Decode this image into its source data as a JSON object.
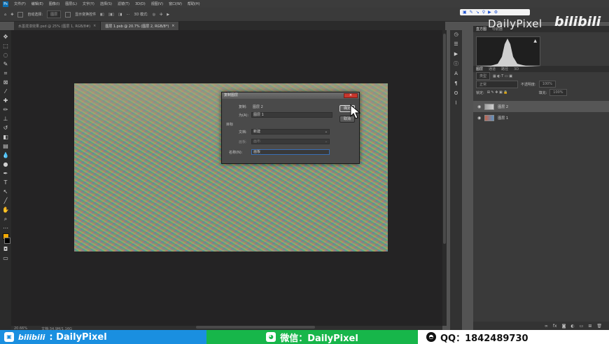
{
  "menubar": {
    "app_icon": "Ps",
    "items": [
      "文件(F)",
      "编辑(E)",
      "图像(I)",
      "图层(L)",
      "文字(Y)",
      "选择(S)",
      "滤镜(T)",
      "3D(D)",
      "视图(V)",
      "窗口(W)",
      "帮助(H)"
    ]
  },
  "options_bar": {
    "auto_select_label": "自动选择:",
    "auto_select_value": "图层",
    "show_transform_label": "显示变换控件",
    "mode_3d_label": "3D 模式:"
  },
  "tabs": [
    {
      "label": "水墨泼漆效果.psd @ 25% (图层 1, RGB/8#)",
      "close": "×"
    },
    {
      "label": "图层 1.psb @ 20.7% (图层 2, RGB/8*)",
      "close": "×"
    }
  ],
  "status": {
    "zoom": "20.66%",
    "doc": "文档:34.9M/1.16G"
  },
  "dialog": {
    "title": "复制图层",
    "close": "×",
    "copy_label": "复制:",
    "copy_value": "图层 2",
    "as_label": "为(A):",
    "as_value": "图层 1",
    "target_label": "目标",
    "doc_label": "文档:",
    "doc_value": "新建",
    "artboard_label": "画板:",
    "artboard_value": "画布",
    "name_label": "名称(N):",
    "name_value": "画板",
    "ok_label": "确定",
    "cancel_label": "取消"
  },
  "right_panel": {
    "histo_tabs": [
      "直方图",
      "导航器"
    ],
    "layer_tabs": [
      "图层",
      "通道",
      "路径",
      "3D"
    ],
    "kind_label": "类型",
    "blend_mode": "正常",
    "opacity_label": "不透明度:",
    "opacity_value": "100%",
    "lock_label": "锁定:",
    "fill_label": "填充:",
    "fill_value": "100%",
    "layers": [
      {
        "name": "图层 2",
        "selected": true
      },
      {
        "name": "图层 1",
        "selected": false
      }
    ]
  },
  "watermark": {
    "brand": "DailyPixel",
    "bilibili": "bilibili"
  },
  "footer": {
    "bilibili_prefix": "bilibili",
    "bilibili_text": ": DailyPixel",
    "wechat_text": "微信：DailyPixel",
    "qq_text": "QQ：1842489730"
  },
  "colors": {
    "foreground": "#f2a800",
    "background": "#000000",
    "footer_blue": "#1a8fe0",
    "footer_green": "#17b64a"
  }
}
